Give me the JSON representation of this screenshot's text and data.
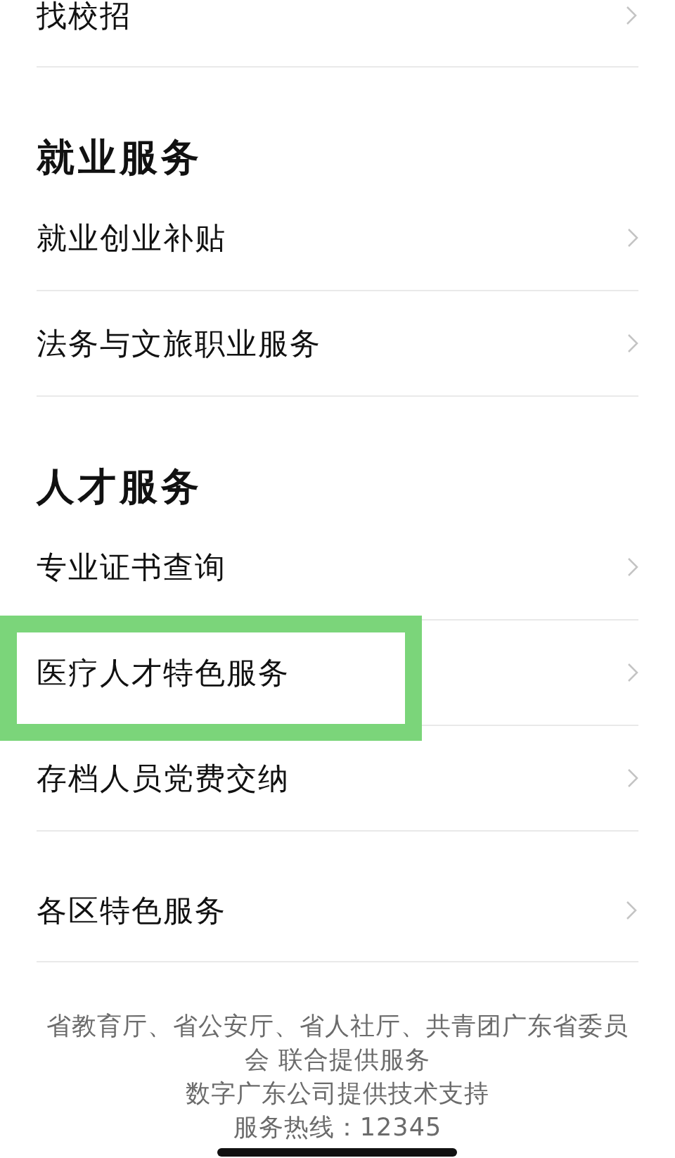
{
  "top_items": [
    {
      "label": "找校招",
      "highlighted": false
    }
  ],
  "sections": [
    {
      "title": "就业服务",
      "items": [
        {
          "label": "就业创业补贴",
          "highlighted": false
        },
        {
          "label": "法务与文旅职业服务",
          "highlighted": false
        }
      ]
    },
    {
      "title": "人才服务",
      "items": [
        {
          "label": "专业证书查询",
          "highlighted": false
        },
        {
          "label": "医疗人才特色服务",
          "highlighted": true
        },
        {
          "label": "存档人员党费交纳",
          "highlighted": false
        }
      ]
    }
  ],
  "extra_items": [
    {
      "label": "各区特色服务",
      "highlighted": false
    }
  ],
  "footer": [
    "省教育厅、省公安厅、省人社厅、共青团广东省委员会 联合提供服务",
    "数字广东公司提供技术支持",
    "服务热线：12345"
  ]
}
